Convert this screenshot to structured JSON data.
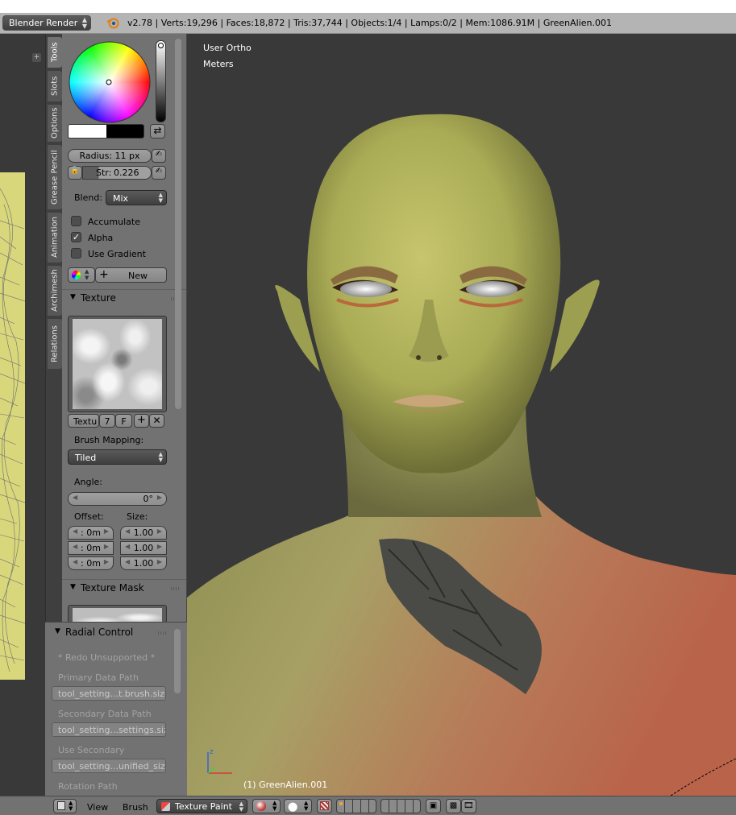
{
  "topbar": {
    "render_engine": "Blender Render",
    "stats": "v2.78 | Verts:19,296 | Faces:18,872 | Tris:37,744 | Objects:1/4 | Lamps:0/2 | Mem:1086.91M | GreenAlien.001"
  },
  "tabs": [
    "Tools",
    "Slots",
    "Options",
    "Grease Pencil",
    "Animation",
    "Archimesh",
    "Relations"
  ],
  "brush": {
    "radius": "Radius:  11 px",
    "strength_label": "Str:",
    "strength_value": "0.226",
    "blend_label": "Blend:",
    "blend_value": "Mix",
    "accumulate": "Accumulate",
    "alpha": "Alpha",
    "use_gradient": "Use Gradient",
    "new_label": "New"
  },
  "texture_panel": {
    "title": "Texture",
    "tex_name": "Textu",
    "users": "7",
    "fake": "F",
    "brush_mapping_label": "Brush Mapping:",
    "brush_mapping_value": "Tiled",
    "angle_label": "Angle:",
    "angle_value": "0°",
    "offset_label": "Offset:",
    "size_label": "Size:",
    "offset_values": [
      ": 0m",
      ": 0m",
      ": 0m"
    ],
    "size_values": [
      "1.00",
      "1.00",
      "1.00"
    ]
  },
  "texture_mask_panel": {
    "title": "Texture Mask"
  },
  "radial_control": {
    "title": "Radial Control",
    "redo_note": "* Redo Unsupported *",
    "primary_label": "Primary Data Path",
    "primary_value": "tool_setting...t.brush.size",
    "secondary_label": "Secondary Data Path",
    "secondary_value": "tool_setting...settings.size",
    "use_secondary_label": "Use Secondary",
    "use_secondary_value": "tool_setting...unified_size",
    "rotation_label": "Rotation Path"
  },
  "viewport": {
    "view_name": "User Ortho",
    "units": "Meters",
    "object_label": "(1) GreenAlien.001"
  },
  "bottombar": {
    "view": "View",
    "brush": "Brush",
    "mode": "Texture Paint"
  },
  "colors": {
    "panel_bg": "#727272",
    "viewport_bg": "#393939",
    "uv_image": "#d8d77c",
    "skin_green": "#a9ab55",
    "skin_red": "#b9644a"
  }
}
